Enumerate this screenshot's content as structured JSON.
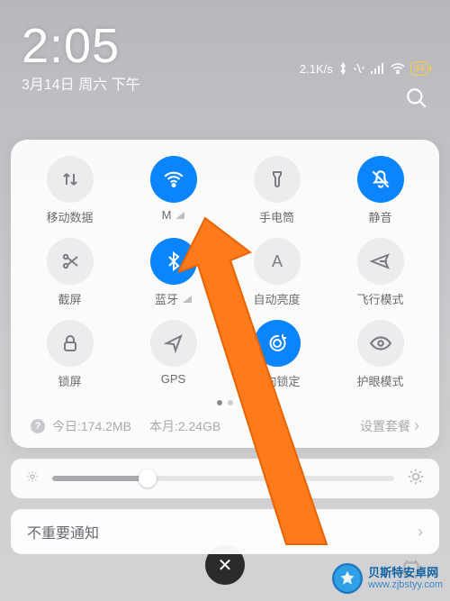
{
  "status": {
    "time": "2:05",
    "date": "3月14日 周六 下午",
    "net_speed": "2.1K/s",
    "battery_pct": "34"
  },
  "tiles": [
    {
      "name": "mobile-data",
      "icon": "updown",
      "label": "移动数据",
      "active": false,
      "signal": false
    },
    {
      "name": "wifi",
      "icon": "wifi",
      "label": "M",
      "active": true,
      "signal": true
    },
    {
      "name": "flashlight",
      "icon": "torch",
      "label": "手电筒",
      "active": false,
      "signal": false
    },
    {
      "name": "mute",
      "icon": "mute",
      "label": "静音",
      "active": true,
      "signal": false
    },
    {
      "name": "screenshot",
      "icon": "scissor",
      "label": "截屏",
      "active": false,
      "signal": false
    },
    {
      "name": "bluetooth",
      "icon": "bluetooth",
      "label": "蓝牙",
      "active": true,
      "signal": true
    },
    {
      "name": "auto-bright",
      "icon": "letter-a",
      "label": "自动亮度",
      "active": false,
      "signal": false
    },
    {
      "name": "airplane",
      "icon": "airplane",
      "label": "飞行模式",
      "active": false,
      "signal": false
    },
    {
      "name": "lock-screen",
      "icon": "lock",
      "label": "锁屏",
      "active": false,
      "signal": false
    },
    {
      "name": "gps",
      "icon": "navigate",
      "label": "GPS",
      "active": false,
      "signal": false
    },
    {
      "name": "rotate-lock",
      "icon": "rotate",
      "label": "方向锁定",
      "active": true,
      "signal": false
    },
    {
      "name": "eye-care",
      "icon": "eye",
      "label": "护眼模式",
      "active": false,
      "signal": false
    }
  ],
  "usage": {
    "today_label": "今日:",
    "today_val": "174.2MB",
    "month_label": "本月:",
    "month_val": "2.24GB",
    "plan_label": "设置套餐"
  },
  "brightness": {
    "percent": 28
  },
  "notification_group": "不重要通知",
  "watermark": {
    "cn": "贝斯特安卓网",
    "url": "www.zjbstyy.com"
  }
}
